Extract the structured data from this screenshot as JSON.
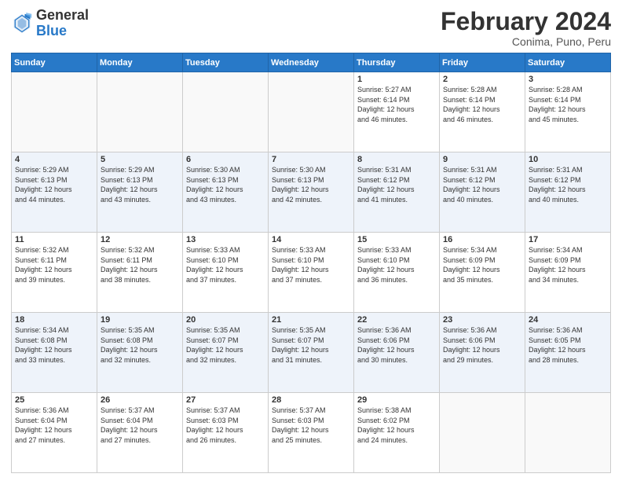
{
  "logo": {
    "line1": "General",
    "line2": "Blue"
  },
  "header": {
    "month_year": "February 2024",
    "location": "Conima, Puno, Peru"
  },
  "days_of_week": [
    "Sunday",
    "Monday",
    "Tuesday",
    "Wednesday",
    "Thursday",
    "Friday",
    "Saturday"
  ],
  "weeks": [
    [
      {
        "day": "",
        "info": ""
      },
      {
        "day": "",
        "info": ""
      },
      {
        "day": "",
        "info": ""
      },
      {
        "day": "",
        "info": ""
      },
      {
        "day": "1",
        "info": "Sunrise: 5:27 AM\nSunset: 6:14 PM\nDaylight: 12 hours\nand 46 minutes."
      },
      {
        "day": "2",
        "info": "Sunrise: 5:28 AM\nSunset: 6:14 PM\nDaylight: 12 hours\nand 46 minutes."
      },
      {
        "day": "3",
        "info": "Sunrise: 5:28 AM\nSunset: 6:14 PM\nDaylight: 12 hours\nand 45 minutes."
      }
    ],
    [
      {
        "day": "4",
        "info": "Sunrise: 5:29 AM\nSunset: 6:13 PM\nDaylight: 12 hours\nand 44 minutes."
      },
      {
        "day": "5",
        "info": "Sunrise: 5:29 AM\nSunset: 6:13 PM\nDaylight: 12 hours\nand 43 minutes."
      },
      {
        "day": "6",
        "info": "Sunrise: 5:30 AM\nSunset: 6:13 PM\nDaylight: 12 hours\nand 43 minutes."
      },
      {
        "day": "7",
        "info": "Sunrise: 5:30 AM\nSunset: 6:13 PM\nDaylight: 12 hours\nand 42 minutes."
      },
      {
        "day": "8",
        "info": "Sunrise: 5:31 AM\nSunset: 6:12 PM\nDaylight: 12 hours\nand 41 minutes."
      },
      {
        "day": "9",
        "info": "Sunrise: 5:31 AM\nSunset: 6:12 PM\nDaylight: 12 hours\nand 40 minutes."
      },
      {
        "day": "10",
        "info": "Sunrise: 5:31 AM\nSunset: 6:12 PM\nDaylight: 12 hours\nand 40 minutes."
      }
    ],
    [
      {
        "day": "11",
        "info": "Sunrise: 5:32 AM\nSunset: 6:11 PM\nDaylight: 12 hours\nand 39 minutes."
      },
      {
        "day": "12",
        "info": "Sunrise: 5:32 AM\nSunset: 6:11 PM\nDaylight: 12 hours\nand 38 minutes."
      },
      {
        "day": "13",
        "info": "Sunrise: 5:33 AM\nSunset: 6:10 PM\nDaylight: 12 hours\nand 37 minutes."
      },
      {
        "day": "14",
        "info": "Sunrise: 5:33 AM\nSunset: 6:10 PM\nDaylight: 12 hours\nand 37 minutes."
      },
      {
        "day": "15",
        "info": "Sunrise: 5:33 AM\nSunset: 6:10 PM\nDaylight: 12 hours\nand 36 minutes."
      },
      {
        "day": "16",
        "info": "Sunrise: 5:34 AM\nSunset: 6:09 PM\nDaylight: 12 hours\nand 35 minutes."
      },
      {
        "day": "17",
        "info": "Sunrise: 5:34 AM\nSunset: 6:09 PM\nDaylight: 12 hours\nand 34 minutes."
      }
    ],
    [
      {
        "day": "18",
        "info": "Sunrise: 5:34 AM\nSunset: 6:08 PM\nDaylight: 12 hours\nand 33 minutes."
      },
      {
        "day": "19",
        "info": "Sunrise: 5:35 AM\nSunset: 6:08 PM\nDaylight: 12 hours\nand 32 minutes."
      },
      {
        "day": "20",
        "info": "Sunrise: 5:35 AM\nSunset: 6:07 PM\nDaylight: 12 hours\nand 32 minutes."
      },
      {
        "day": "21",
        "info": "Sunrise: 5:35 AM\nSunset: 6:07 PM\nDaylight: 12 hours\nand 31 minutes."
      },
      {
        "day": "22",
        "info": "Sunrise: 5:36 AM\nSunset: 6:06 PM\nDaylight: 12 hours\nand 30 minutes."
      },
      {
        "day": "23",
        "info": "Sunrise: 5:36 AM\nSunset: 6:06 PM\nDaylight: 12 hours\nand 29 minutes."
      },
      {
        "day": "24",
        "info": "Sunrise: 5:36 AM\nSunset: 6:05 PM\nDaylight: 12 hours\nand 28 minutes."
      }
    ],
    [
      {
        "day": "25",
        "info": "Sunrise: 5:36 AM\nSunset: 6:04 PM\nDaylight: 12 hours\nand 27 minutes."
      },
      {
        "day": "26",
        "info": "Sunrise: 5:37 AM\nSunset: 6:04 PM\nDaylight: 12 hours\nand 27 minutes."
      },
      {
        "day": "27",
        "info": "Sunrise: 5:37 AM\nSunset: 6:03 PM\nDaylight: 12 hours\nand 26 minutes."
      },
      {
        "day": "28",
        "info": "Sunrise: 5:37 AM\nSunset: 6:03 PM\nDaylight: 12 hours\nand 25 minutes."
      },
      {
        "day": "29",
        "info": "Sunrise: 5:38 AM\nSunset: 6:02 PM\nDaylight: 12 hours\nand 24 minutes."
      },
      {
        "day": "",
        "info": ""
      },
      {
        "day": "",
        "info": ""
      }
    ]
  ]
}
